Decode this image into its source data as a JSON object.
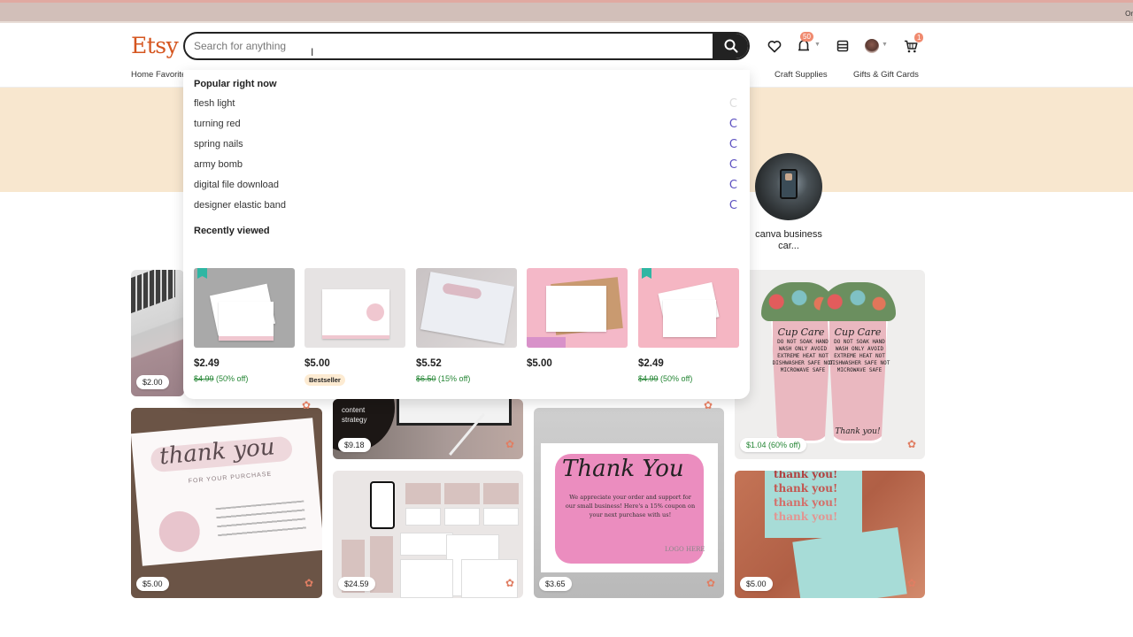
{
  "browser": {
    "corner_text": "Or"
  },
  "header": {
    "logo": "Etsy",
    "search": {
      "placeholder": "Search for anything",
      "value": ""
    },
    "icons": {
      "search": "search-icon",
      "favorites": "heart-icon",
      "notifications": "bell-icon",
      "shop_manager": "store-icon",
      "account": "avatar",
      "cart": "cart-icon"
    },
    "notification_count": "50",
    "cart_count": "1"
  },
  "nav": {
    "items": [
      {
        "label": "Home Favorites"
      },
      {
        "label": "Craft Supplies"
      },
      {
        "label": "Gifts & Gift Cards"
      }
    ]
  },
  "dropdown": {
    "popular_heading": "Popular right now",
    "suggestions": [
      {
        "label": "flesh light",
        "icon": "loading-spinner-icon"
      },
      {
        "label": "turning red",
        "icon": "loading-spinner-icon"
      },
      {
        "label": "spring nails",
        "icon": "loading-spinner-icon"
      },
      {
        "label": "army bomb",
        "icon": "loading-spinner-icon"
      },
      {
        "label": "digital file download",
        "icon": "loading-spinner-icon"
      },
      {
        "label": "designer elastic band",
        "icon": "loading-spinner-icon"
      }
    ],
    "recent_heading": "Recently viewed",
    "recent_items": [
      {
        "price": "$2.49",
        "original": "$4.99",
        "discount": "(50% off)",
        "badge": "",
        "bookmark": true
      },
      {
        "price": "$5.00",
        "original": "",
        "discount": "",
        "badge": "Bestseller",
        "bookmark": false
      },
      {
        "price": "$5.52",
        "original": "$6.50",
        "discount": "(15% off)",
        "badge": "",
        "bookmark": false
      },
      {
        "price": "$5.00",
        "original": "",
        "discount": "",
        "badge": "",
        "bookmark": false
      },
      {
        "price": "$2.49",
        "original": "$4.99",
        "discount": "(50% off)",
        "badge": "",
        "bookmark": true
      }
    ]
  },
  "circle_category": {
    "label": "canva business car..."
  },
  "grid": {
    "tiles": [
      {
        "price": "$2.00",
        "alt": "laptop desk"
      },
      {
        "price": "$5.00",
        "alt": "thank you for your purchase card",
        "card_title": "thank you",
        "card_sub": "FOR YOUR PURCHASE"
      },
      {
        "price": "$9.18",
        "alt": "content strategy planner",
        "overlay_text": "content strategy"
      },
      {
        "price": "$24.59",
        "alt": "brand kit templates"
      },
      {
        "price": "$3.65",
        "alt": "pink thank you card",
        "card_title": "Thank You",
        "card_msg": "We appreciate your order and support for our small business! Here's a 15% coupon on your next purchase with us!",
        "logo_text": "LOGO HERE"
      },
      {
        "price": "$1.04 (60% off)",
        "alt": "cup care cards",
        "card_title": "Cup Care",
        "card_lines": "DO NOT SOAK HAND WASH ONLY AVOID EXTREME HEAT NOT DISHWASHER SAFE NOT MICROWAVE SAFE",
        "card_footer": "Thank you!"
      },
      {
        "price": "$5.00",
        "alt": "retro thank you cards",
        "card_text": "thank you!"
      }
    ]
  },
  "colors": {
    "brand": "#d5551f",
    "sale_green": "#258635",
    "spinner_purple": "#5b4fc0",
    "hero_band": "#f8e7cf",
    "badge": "#f08a6f"
  }
}
